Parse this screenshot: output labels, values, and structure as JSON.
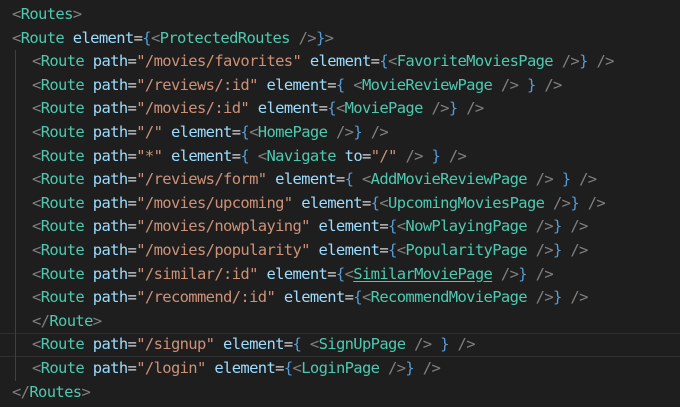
{
  "editor": {
    "lines": [
      {
        "indent": 0,
        "tokens": [
          [
            "punc",
            "<"
          ],
          [
            "tag",
            "Routes"
          ],
          [
            "punc",
            ">"
          ]
        ]
      },
      {
        "indent": 0,
        "tokens": [
          [
            "punc",
            "<"
          ],
          [
            "tag",
            "Route"
          ],
          [
            "eq",
            " "
          ],
          [
            "attr",
            "element"
          ],
          [
            "eq",
            "="
          ],
          [
            "brace",
            "{"
          ],
          [
            "punc",
            "<"
          ],
          [
            "tag",
            "ProtectedRoutes"
          ],
          [
            "eq",
            " "
          ],
          [
            "punc",
            "/>"
          ],
          [
            "brace",
            "}"
          ],
          [
            "punc",
            ">"
          ]
        ]
      },
      {
        "indent": 1,
        "tokens": [
          [
            "punc",
            "<"
          ],
          [
            "tag",
            "Route"
          ],
          [
            "eq",
            " "
          ],
          [
            "attr",
            "path"
          ],
          [
            "eq",
            "="
          ],
          [
            "str",
            "\"/movies/favorites\""
          ],
          [
            "eq",
            " "
          ],
          [
            "attr",
            "element"
          ],
          [
            "eq",
            "="
          ],
          [
            "brace",
            "{"
          ],
          [
            "punc",
            "<"
          ],
          [
            "tag",
            "FavoriteMoviesPage"
          ],
          [
            "eq",
            " "
          ],
          [
            "punc",
            "/>"
          ],
          [
            "brace",
            "}"
          ],
          [
            "eq",
            " "
          ],
          [
            "punc",
            "/>"
          ]
        ]
      },
      {
        "indent": 1,
        "tokens": [
          [
            "punc",
            "<"
          ],
          [
            "tag",
            "Route"
          ],
          [
            "eq",
            " "
          ],
          [
            "attr",
            "path"
          ],
          [
            "eq",
            "="
          ],
          [
            "str",
            "\"/reviews/:id\""
          ],
          [
            "eq",
            " "
          ],
          [
            "attr",
            "element"
          ],
          [
            "eq",
            "="
          ],
          [
            "brace",
            "{"
          ],
          [
            "eq",
            " "
          ],
          [
            "punc",
            "<"
          ],
          [
            "tag",
            "MovieReviewPage"
          ],
          [
            "eq",
            " "
          ],
          [
            "punc",
            "/>"
          ],
          [
            "eq",
            " "
          ],
          [
            "brace",
            "}"
          ],
          [
            "eq",
            " "
          ],
          [
            "punc",
            "/>"
          ]
        ]
      },
      {
        "indent": 1,
        "tokens": [
          [
            "punc",
            "<"
          ],
          [
            "tag",
            "Route"
          ],
          [
            "eq",
            " "
          ],
          [
            "attr",
            "path"
          ],
          [
            "eq",
            "="
          ],
          [
            "str",
            "\"/movies/:id\""
          ],
          [
            "eq",
            " "
          ],
          [
            "attr",
            "element"
          ],
          [
            "eq",
            "="
          ],
          [
            "brace",
            "{"
          ],
          [
            "punc",
            "<"
          ],
          [
            "tag",
            "MoviePage"
          ],
          [
            "eq",
            " "
          ],
          [
            "punc",
            "/>"
          ],
          [
            "brace",
            "}"
          ],
          [
            "eq",
            " "
          ],
          [
            "punc",
            "/>"
          ]
        ]
      },
      {
        "indent": 1,
        "tokens": [
          [
            "punc",
            "<"
          ],
          [
            "tag",
            "Route"
          ],
          [
            "eq",
            " "
          ],
          [
            "attr",
            "path"
          ],
          [
            "eq",
            "="
          ],
          [
            "str",
            "\"/\""
          ],
          [
            "eq",
            " "
          ],
          [
            "attr",
            "element"
          ],
          [
            "eq",
            "="
          ],
          [
            "brace",
            "{"
          ],
          [
            "punc",
            "<"
          ],
          [
            "tag",
            "HomePage"
          ],
          [
            "eq",
            " "
          ],
          [
            "punc",
            "/>"
          ],
          [
            "brace",
            "}"
          ],
          [
            "eq",
            " "
          ],
          [
            "punc",
            "/>"
          ]
        ]
      },
      {
        "indent": 1,
        "tokens": [
          [
            "punc",
            "<"
          ],
          [
            "tag",
            "Route"
          ],
          [
            "eq",
            " "
          ],
          [
            "attr",
            "path"
          ],
          [
            "eq",
            "="
          ],
          [
            "str",
            "\"*\""
          ],
          [
            "eq",
            " "
          ],
          [
            "attr",
            "element"
          ],
          [
            "eq",
            "="
          ],
          [
            "brace",
            "{"
          ],
          [
            "eq",
            " "
          ],
          [
            "punc",
            "<"
          ],
          [
            "tag",
            "Navigate"
          ],
          [
            "eq",
            " "
          ],
          [
            "attr",
            "to"
          ],
          [
            "eq",
            "="
          ],
          [
            "str",
            "\"/\""
          ],
          [
            "eq",
            " "
          ],
          [
            "punc",
            "/>"
          ],
          [
            "eq",
            " "
          ],
          [
            "brace",
            "}"
          ],
          [
            "eq",
            " "
          ],
          [
            "punc",
            "/>"
          ]
        ]
      },
      {
        "indent": 1,
        "tokens": [
          [
            "punc",
            "<"
          ],
          [
            "tag",
            "Route"
          ],
          [
            "eq",
            " "
          ],
          [
            "attr",
            "path"
          ],
          [
            "eq",
            "="
          ],
          [
            "str",
            "\"/reviews/form\""
          ],
          [
            "eq",
            " "
          ],
          [
            "attr",
            "element"
          ],
          [
            "eq",
            "="
          ],
          [
            "brace",
            "{"
          ],
          [
            "eq",
            " "
          ],
          [
            "punc",
            "<"
          ],
          [
            "tag",
            "AddMovieReviewPage"
          ],
          [
            "eq",
            " "
          ],
          [
            "punc",
            "/>"
          ],
          [
            "eq",
            " "
          ],
          [
            "brace",
            "}"
          ],
          [
            "eq",
            " "
          ],
          [
            "punc",
            "/>"
          ]
        ]
      },
      {
        "indent": 1,
        "tokens": [
          [
            "punc",
            "<"
          ],
          [
            "tag",
            "Route"
          ],
          [
            "eq",
            " "
          ],
          [
            "attr",
            "path"
          ],
          [
            "eq",
            "="
          ],
          [
            "str",
            "\"/movies/upcoming\""
          ],
          [
            "eq",
            " "
          ],
          [
            "attr",
            "element"
          ],
          [
            "eq",
            "="
          ],
          [
            "brace",
            "{"
          ],
          [
            "punc",
            "<"
          ],
          [
            "tag",
            "UpcomingMoviesPage"
          ],
          [
            "eq",
            " "
          ],
          [
            "punc",
            "/>"
          ],
          [
            "brace",
            "}"
          ],
          [
            "eq",
            " "
          ],
          [
            "punc",
            "/>"
          ]
        ]
      },
      {
        "indent": 1,
        "tokens": [
          [
            "punc",
            "<"
          ],
          [
            "tag",
            "Route"
          ],
          [
            "eq",
            " "
          ],
          [
            "attr",
            "path"
          ],
          [
            "eq",
            "="
          ],
          [
            "str",
            "\"/movies/nowplaying\""
          ],
          [
            "eq",
            " "
          ],
          [
            "attr",
            "element"
          ],
          [
            "eq",
            "="
          ],
          [
            "brace",
            "{"
          ],
          [
            "punc",
            "<"
          ],
          [
            "tag",
            "NowPlayingPage"
          ],
          [
            "eq",
            " "
          ],
          [
            "punc",
            "/>"
          ],
          [
            "brace",
            "}"
          ],
          [
            "eq",
            " "
          ],
          [
            "punc",
            "/>"
          ]
        ]
      },
      {
        "indent": 1,
        "tokens": [
          [
            "punc",
            "<"
          ],
          [
            "tag",
            "Route"
          ],
          [
            "eq",
            " "
          ],
          [
            "attr",
            "path"
          ],
          [
            "eq",
            "="
          ],
          [
            "str",
            "\"/movies/popularity\""
          ],
          [
            "eq",
            " "
          ],
          [
            "attr",
            "element"
          ],
          [
            "eq",
            "="
          ],
          [
            "brace",
            "{"
          ],
          [
            "punc",
            "<"
          ],
          [
            "tag",
            "PopularityPage"
          ],
          [
            "eq",
            " "
          ],
          [
            "punc",
            "/>"
          ],
          [
            "brace",
            "}"
          ],
          [
            "eq",
            " "
          ],
          [
            "punc",
            "/>"
          ]
        ]
      },
      {
        "indent": 1,
        "tokens": [
          [
            "punc",
            "<"
          ],
          [
            "tag",
            "Route"
          ],
          [
            "eq",
            " "
          ],
          [
            "attr",
            "path"
          ],
          [
            "eq",
            "="
          ],
          [
            "str",
            "\"/similar/:id\""
          ],
          [
            "eq",
            " "
          ],
          [
            "attr",
            "element"
          ],
          [
            "eq",
            "="
          ],
          [
            "brace",
            "{"
          ],
          [
            "punc",
            "<"
          ],
          [
            "tag link",
            "SimilarMoviePage"
          ],
          [
            "eq",
            " "
          ],
          [
            "punc",
            "/>"
          ],
          [
            "brace",
            "}"
          ],
          [
            "eq",
            " "
          ],
          [
            "punc",
            "/>"
          ]
        ]
      },
      {
        "indent": 1,
        "tokens": [
          [
            "punc",
            "<"
          ],
          [
            "tag",
            "Route"
          ],
          [
            "eq",
            " "
          ],
          [
            "attr",
            "path"
          ],
          [
            "eq",
            "="
          ],
          [
            "str",
            "\"/recommend/:id\""
          ],
          [
            "eq",
            " "
          ],
          [
            "attr",
            "element"
          ],
          [
            "eq",
            "="
          ],
          [
            "brace",
            "{"
          ],
          [
            "punc",
            "<"
          ],
          [
            "tag",
            "RecommendMoviePage"
          ],
          [
            "eq",
            " "
          ],
          [
            "punc",
            "/>"
          ],
          [
            "brace",
            "}"
          ],
          [
            "eq",
            " "
          ],
          [
            "punc",
            "/>"
          ]
        ]
      },
      {
        "indent": 1,
        "tokens": [
          [
            "punc",
            "</"
          ],
          [
            "tag",
            "Route"
          ],
          [
            "punc",
            ">"
          ]
        ]
      },
      {
        "indent": 1,
        "cursor": true,
        "tokens": [
          [
            "punc",
            "<"
          ],
          [
            "tag",
            "Route"
          ],
          [
            "eq",
            " "
          ],
          [
            "attr",
            "path"
          ],
          [
            "eq",
            "="
          ],
          [
            "str",
            "\"/signup\""
          ],
          [
            "eq",
            " "
          ],
          [
            "attr",
            "element"
          ],
          [
            "eq",
            "="
          ],
          [
            "brace",
            "{"
          ],
          [
            "eq",
            " "
          ],
          [
            "punc",
            "<"
          ],
          [
            "tag",
            "SignUpPage"
          ],
          [
            "eq",
            " "
          ],
          [
            "punc",
            "/>"
          ],
          [
            "eq",
            " "
          ],
          [
            "brace",
            "}"
          ],
          [
            "eq",
            " "
          ],
          [
            "punc",
            "/>"
          ]
        ]
      },
      {
        "indent": 1,
        "tokens": [
          [
            "punc",
            "<"
          ],
          [
            "tag",
            "Route"
          ],
          [
            "eq",
            " "
          ],
          [
            "attr",
            "path"
          ],
          [
            "eq",
            "="
          ],
          [
            "str",
            "\"/login\""
          ],
          [
            "eq",
            " "
          ],
          [
            "attr",
            "element"
          ],
          [
            "eq",
            "="
          ],
          [
            "brace",
            "{"
          ],
          [
            "punc",
            "<"
          ],
          [
            "tag",
            "LoginPage"
          ],
          [
            "eq",
            " "
          ],
          [
            "punc",
            "/>"
          ],
          [
            "brace",
            "}"
          ],
          [
            "eq",
            " "
          ],
          [
            "punc",
            "/>"
          ]
        ]
      },
      {
        "indent": 0,
        "tokens": [
          [
            "punc",
            "</"
          ],
          [
            "tag",
            "Routes"
          ],
          [
            "punc",
            ">"
          ]
        ]
      }
    ]
  },
  "colors": {
    "background": "#1e1e1e",
    "punctuation": "#808080",
    "tag": "#4ec9b0",
    "attribute": "#9cdcfe",
    "string": "#ce9178",
    "brace": "#569cd6",
    "text": "#d4d4d4"
  }
}
